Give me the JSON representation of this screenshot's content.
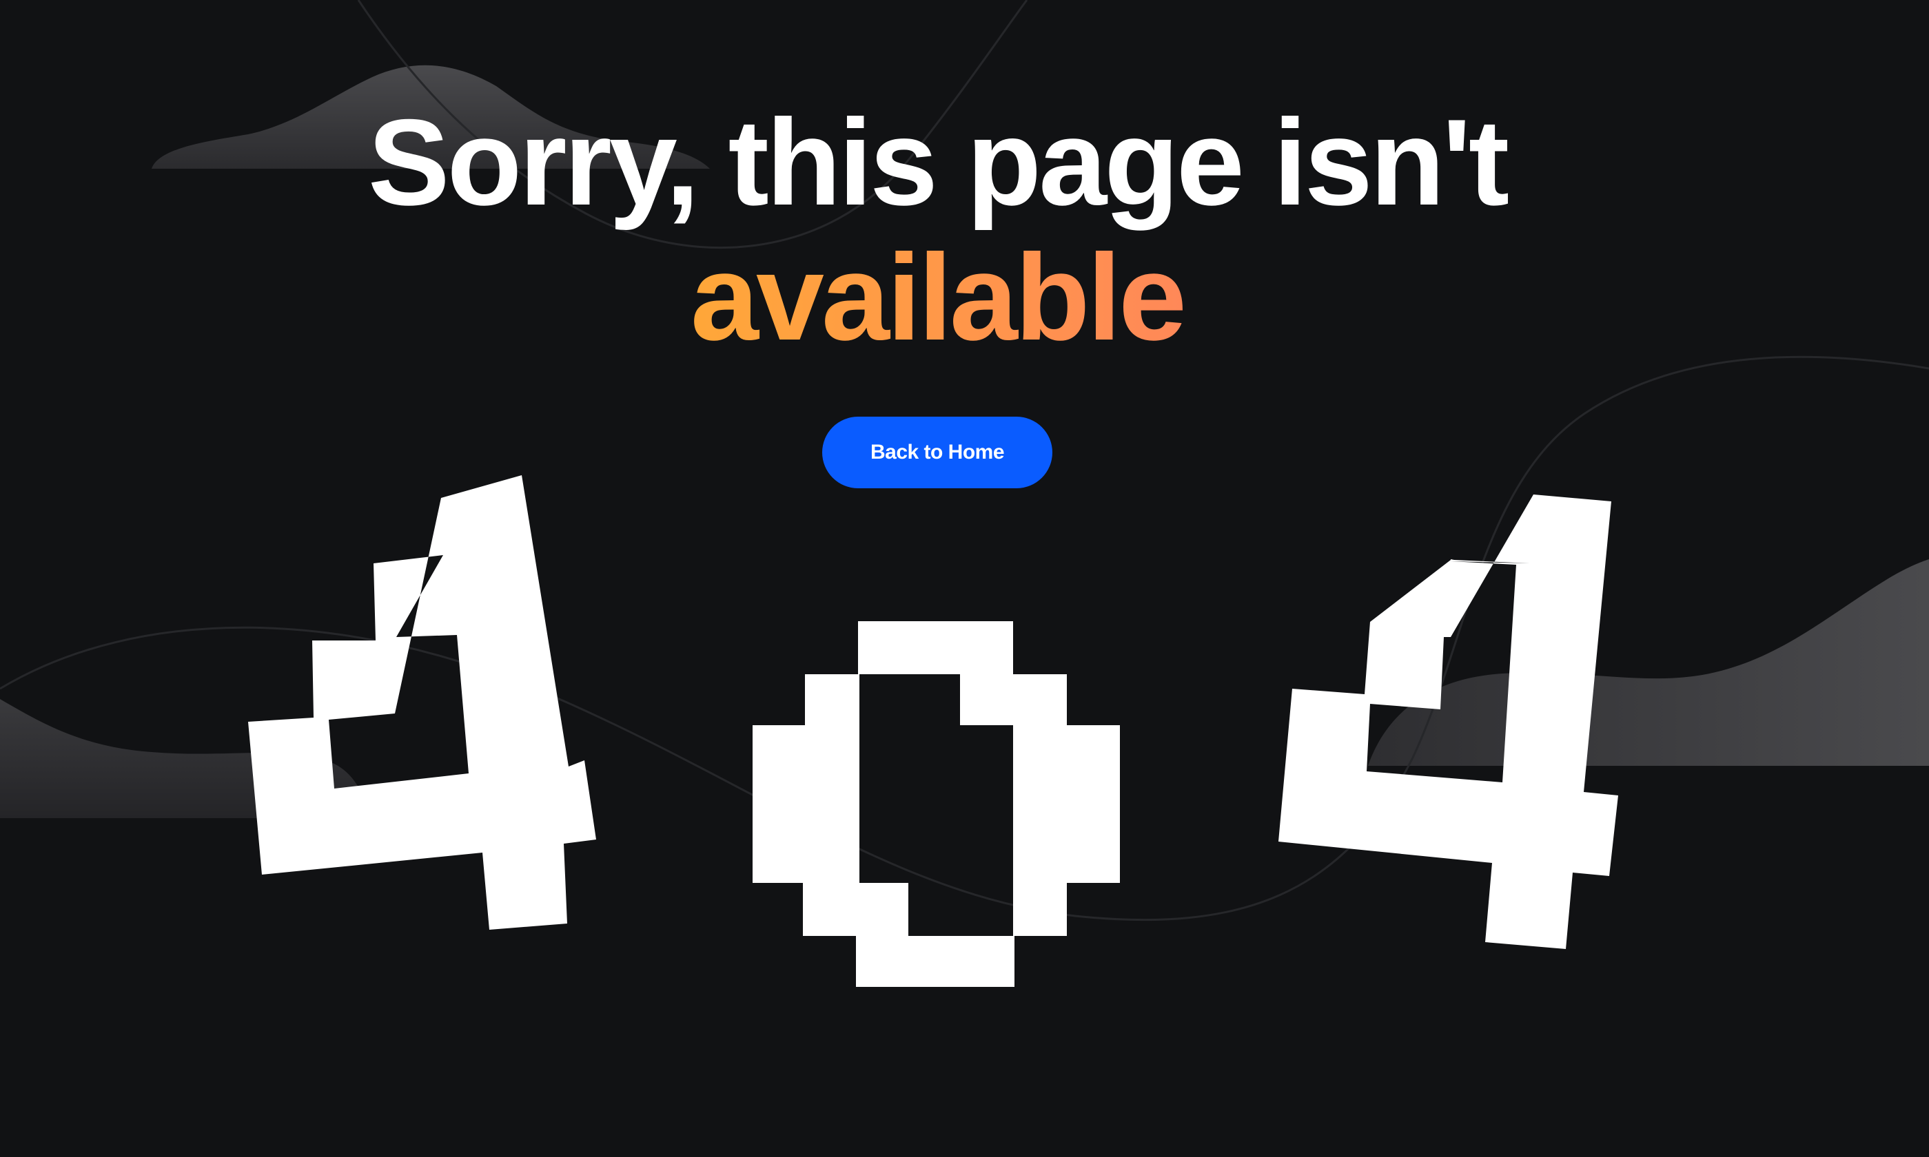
{
  "page": {
    "background_color": "#111214"
  },
  "headline": {
    "line1": "Sorry, this page isn't",
    "line2": "available",
    "gradient_colors": [
      "#ffc400",
      "#ffa43d",
      "#ff7a66",
      "#ff5c92"
    ]
  },
  "actions": {
    "back_home_label": "Back to Home",
    "button_color": "#0a5cff"
  },
  "illustration": {
    "digits": [
      "4",
      "0",
      "4"
    ],
    "style": "pixel",
    "color": "#ffffff"
  }
}
